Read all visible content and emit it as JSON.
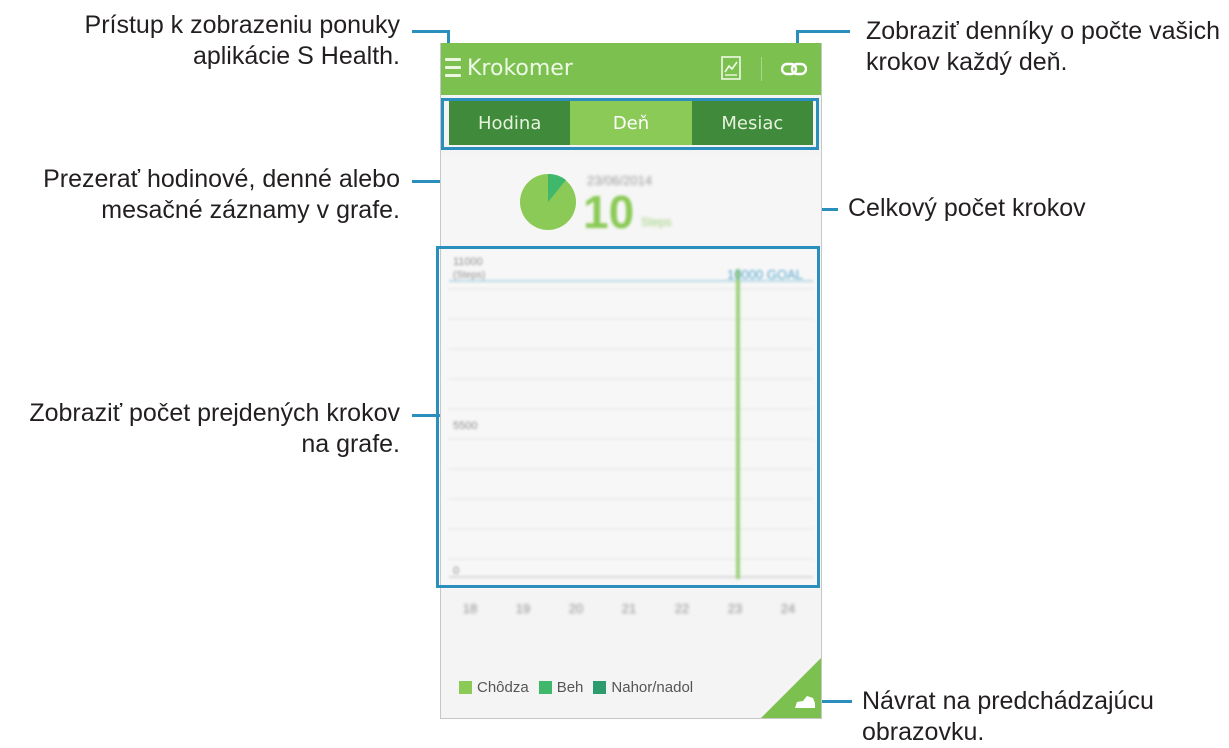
{
  "annotations": {
    "menu_access": [
      "Prístup k zobrazeniu ponuky",
      "aplikácie S Health."
    ],
    "daily_logs": [
      "Zobraziť denníky o počte vašich",
      "krokov každý deň."
    ],
    "view_records": [
      "Prezerať hodinové, denné alebo",
      "mesačné záznamy v grafe."
    ],
    "total_steps": "Celkový počet krokov",
    "graph_steps": [
      "Zobraziť počet prejdených krokov",
      "na grafe."
    ],
    "go_back": [
      "Návrat na predchádzajúcu",
      "obrazovku."
    ]
  },
  "app": {
    "title": "Krokomer",
    "tabs": [
      {
        "label": "Hodina",
        "active": false
      },
      {
        "label": "Deň",
        "active": true
      },
      {
        "label": "Mesiac",
        "active": false
      }
    ],
    "summary": {
      "date": "23/06/2014",
      "steps": "10",
      "unit": "Steps"
    },
    "graph": {
      "y_labels": [
        "11000",
        "(Steps)",
        "5500",
        "0"
      ],
      "goal_label": "10000 GOAL",
      "x_labels": [
        "18",
        "19",
        "20",
        "21",
        "22",
        "23",
        "24"
      ]
    },
    "legend": [
      {
        "label": "Chôdza",
        "color": "#8bca57"
      },
      {
        "label": "Beh",
        "color": "#3fb86c"
      },
      {
        "label": "Nahor/nadol",
        "color": "#2e9b6e"
      }
    ]
  },
  "colors": {
    "accent_green": "#7cc150",
    "dark_green": "#3f8a3b",
    "callout_blue": "#2a8fbd"
  }
}
